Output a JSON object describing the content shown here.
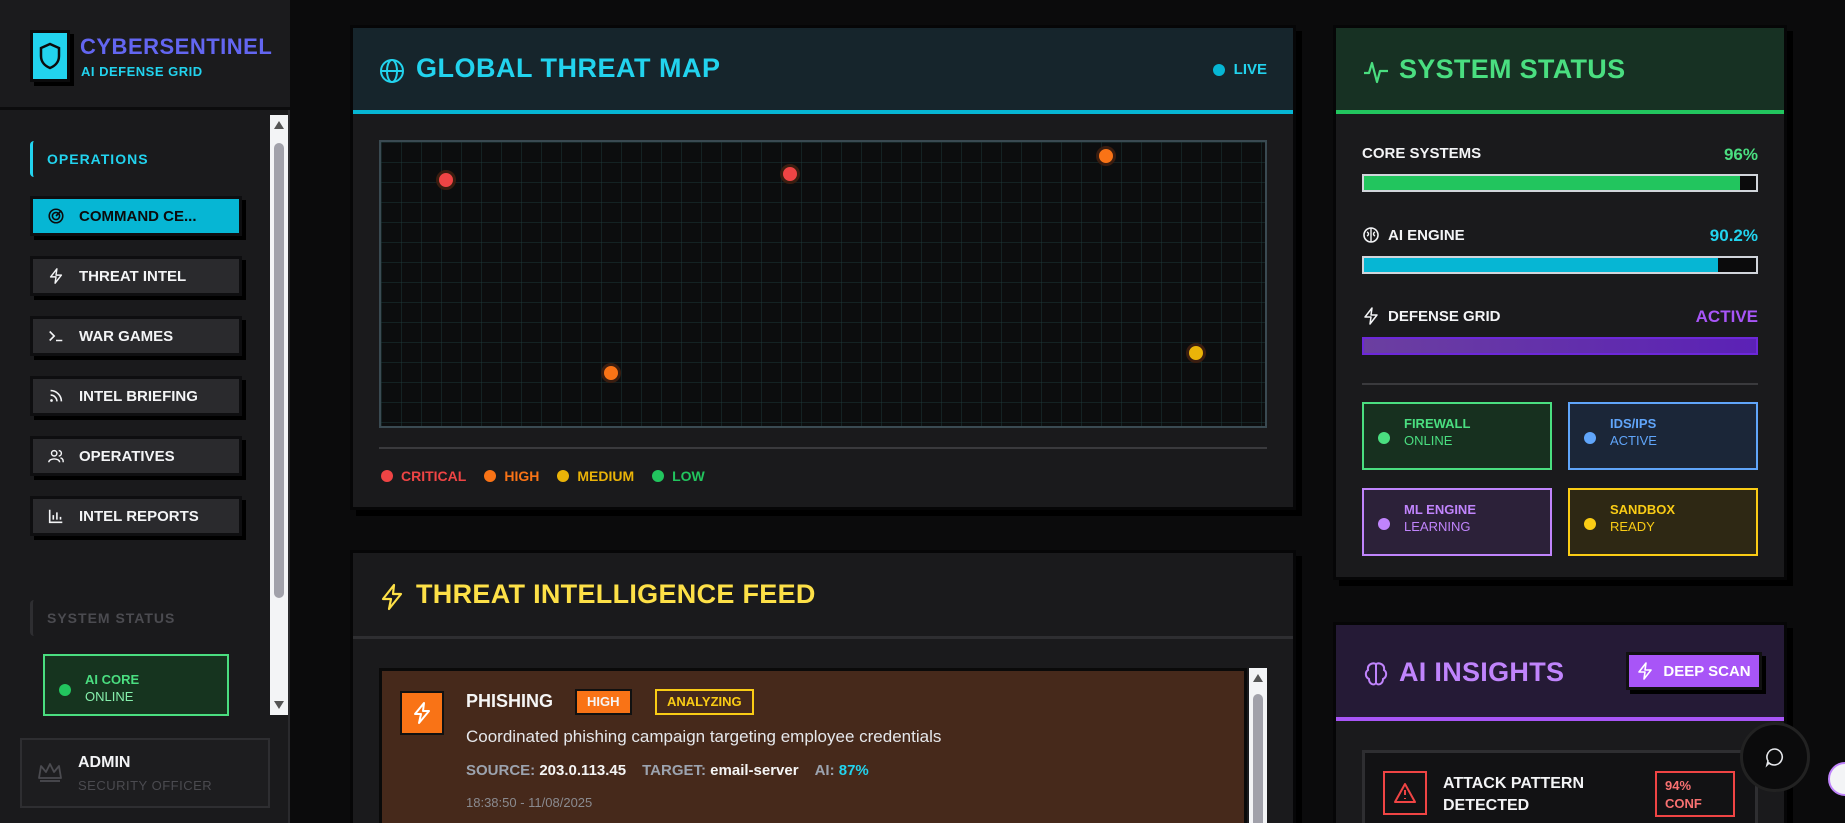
{
  "brand": {
    "title": "CYBERSENTINEL",
    "subtitle": "AI DEFENSE GRID"
  },
  "sidebar": {
    "operations_label": "OPERATIONS",
    "items": [
      {
        "label": "COMMAND CE...",
        "icon": "radar-icon",
        "active": true
      },
      {
        "label": "THREAT INTEL",
        "icon": "zap-icon",
        "active": false
      },
      {
        "label": "WAR GAMES",
        "icon": "terminal-icon",
        "active": false
      },
      {
        "label": "INTEL BRIEFING",
        "icon": "rss-icon",
        "active": false
      },
      {
        "label": "OPERATIVES",
        "icon": "users-icon",
        "active": false
      },
      {
        "label": "INTEL REPORTS",
        "icon": "bar-chart-icon",
        "active": false
      }
    ],
    "system_status_label": "SYSTEM STATUS",
    "status_card": {
      "title": "AI CORE",
      "state": "ONLINE"
    }
  },
  "user": {
    "name": "ADMIN",
    "role": "SECURITY OFFICER",
    "icon": "crown-icon"
  },
  "threat_map": {
    "title": "GLOBAL THREAT MAP",
    "live_label": "LIVE",
    "legend": [
      {
        "label": "CRITICAL",
        "color": "#ef4444"
      },
      {
        "label": "HIGH",
        "color": "#f97316"
      },
      {
        "label": "MEDIUM",
        "color": "#eab308"
      },
      {
        "label": "LOW",
        "color": "#22c55e"
      }
    ],
    "points": [
      {
        "severity": "CRITICAL",
        "color": "#ef4444",
        "fx": 0.073,
        "fy": 0.132
      },
      {
        "severity": "CRITICAL",
        "color": "#ef4444",
        "fx": 0.461,
        "fy": 0.112
      },
      {
        "severity": "HIGH",
        "color": "#f97316",
        "fx": 0.816,
        "fy": 0.049
      },
      {
        "severity": "HIGH",
        "color": "#f97316",
        "fx": 0.259,
        "fy": 0.801
      },
      {
        "severity": "MEDIUM",
        "color": "#eab308",
        "fx": 0.918,
        "fy": 0.731
      }
    ]
  },
  "feed": {
    "title": "THREAT INTELLIGENCE FEED",
    "items": [
      {
        "type": "PHISHING",
        "severity": "HIGH",
        "status": "ANALYZING",
        "description": "Coordinated phishing campaign targeting employee credentials",
        "source_label": "SOURCE:",
        "source": "203.0.113.45",
        "target_label": "TARGET:",
        "target": "email-server",
        "ai_label": "AI:",
        "ai": "87%",
        "timestamp": "18:38:50 - 11/08/2025"
      }
    ]
  },
  "system_status": {
    "title": "SYSTEM STATUS",
    "metrics": [
      {
        "label": "CORE SYSTEMS",
        "value": "96%",
        "fill": 0.96,
        "color": "#22c55e",
        "icon": ""
      },
      {
        "label": "AI ENGINE",
        "value": "90.2%",
        "fill": 0.902,
        "color": "#06b6d4",
        "icon": "brain-icon"
      },
      {
        "label": "DEFENSE GRID",
        "value": "ACTIVE",
        "fill": 1.0,
        "color": "#6d28d9",
        "icon": "zap-icon"
      }
    ],
    "services": [
      {
        "name": "FIREWALL",
        "state": "ONLINE",
        "color": "#4ade80",
        "bg": "#17301f"
      },
      {
        "name": "IDS/IPS",
        "state": "ACTIVE",
        "color": "#60a5fa",
        "bg": "#1b2638"
      },
      {
        "name": "ML ENGINE",
        "state": "LEARNING",
        "color": "#c084fc",
        "bg": "#2c2139"
      },
      {
        "name": "SANDBOX",
        "state": "READY",
        "color": "#facc15",
        "bg": "#2e2814"
      }
    ]
  },
  "ai_insights": {
    "title": "AI INSIGHTS",
    "deep_scan_label": "DEEP SCAN",
    "alert": {
      "title": "ATTACK PATTERN DETECTED",
      "confidence": "94%",
      "confidence_label": "CONF"
    }
  }
}
